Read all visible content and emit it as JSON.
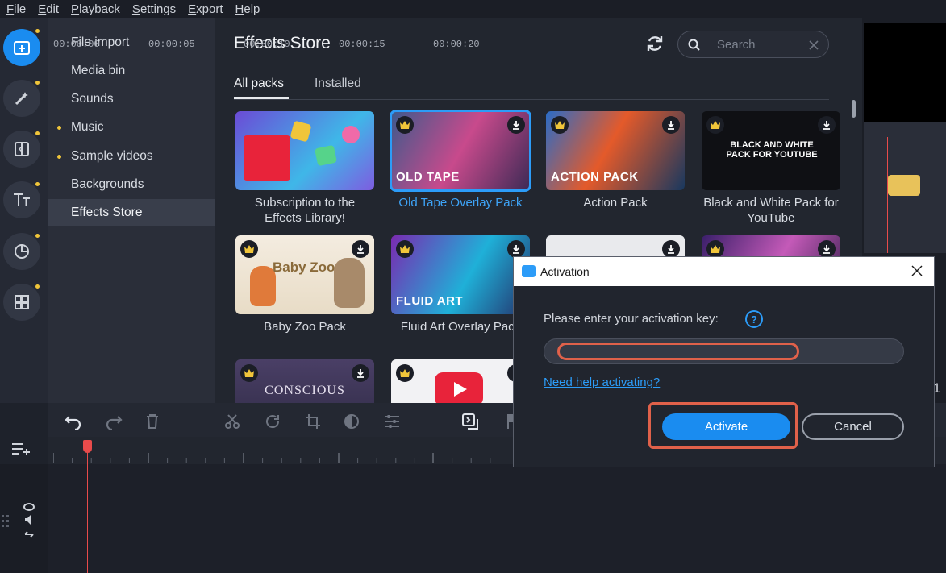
{
  "menu": [
    "File",
    "Edit",
    "Playback",
    "Settings",
    "Export",
    "Help"
  ],
  "rail": {
    "icons": [
      "import-icon",
      "magic-wand-icon",
      "transition-icon",
      "titles-icon",
      "stickers-icon",
      "apps-grid-icon"
    ]
  },
  "sidebar": {
    "items": [
      {
        "label": "File import",
        "bullet": false
      },
      {
        "label": "Media bin",
        "bullet": false
      },
      {
        "label": "Sounds",
        "bullet": false
      },
      {
        "label": "Music",
        "bullet": true
      },
      {
        "label": "Sample videos",
        "bullet": true
      },
      {
        "label": "Backgrounds",
        "bullet": false
      },
      {
        "label": "Effects Store",
        "bullet": false,
        "active": true
      }
    ]
  },
  "store": {
    "title": "Effects Store",
    "search_placeholder": "Search",
    "tabs": [
      "All packs",
      "Installed"
    ],
    "cards": [
      {
        "label": "Subscription to the Effects Library!",
        "thumb_text": "",
        "crown": false,
        "download": false
      },
      {
        "label": "Old Tape Overlay Pack",
        "thumb_text": "OLD TAPE",
        "crown": true,
        "download": true,
        "selected": true
      },
      {
        "label": "Action Pack",
        "thumb_text": "ACTION PACK",
        "crown": true,
        "download": true
      },
      {
        "label": "Black and White Pack for YouTube",
        "thumb_text": "BLACK AND WHITE PACK FOR YOUTUBE",
        "crown": true,
        "download": true
      },
      {
        "label": "Baby Zoo Pack",
        "thumb_text": "Baby Zoo",
        "crown": true,
        "download": true
      },
      {
        "label": "Fluid Art Overlay Pack",
        "thumb_text": "FLUID ART",
        "crown": true,
        "download": true
      },
      {
        "label": "",
        "thumb_text": "",
        "crown": false,
        "download": true
      },
      {
        "label": "",
        "thumb_text": "",
        "crown": true,
        "download": true
      },
      {
        "label": "",
        "thumb_text": "CONSCIOUS",
        "crown": true,
        "download": true
      },
      {
        "label": "",
        "thumb_text": "",
        "crown": true,
        "download": true
      }
    ]
  },
  "timeline": {
    "ticks": [
      "00:00:00",
      "00:00:05",
      "00:00:10",
      "00:00:15",
      "00:00:20"
    ],
    "partial_label": "1"
  },
  "dialog": {
    "title": "Activation",
    "prompt": "Please enter your activation key:",
    "help_symbol": "?",
    "key_value": "",
    "help_link": "Need help activating?",
    "activate_label": "Activate",
    "cancel_label": "Cancel"
  },
  "colors": {
    "accent": "#1a8cf0",
    "highlight": "#e0614a",
    "premium": "#f0c53a"
  }
}
